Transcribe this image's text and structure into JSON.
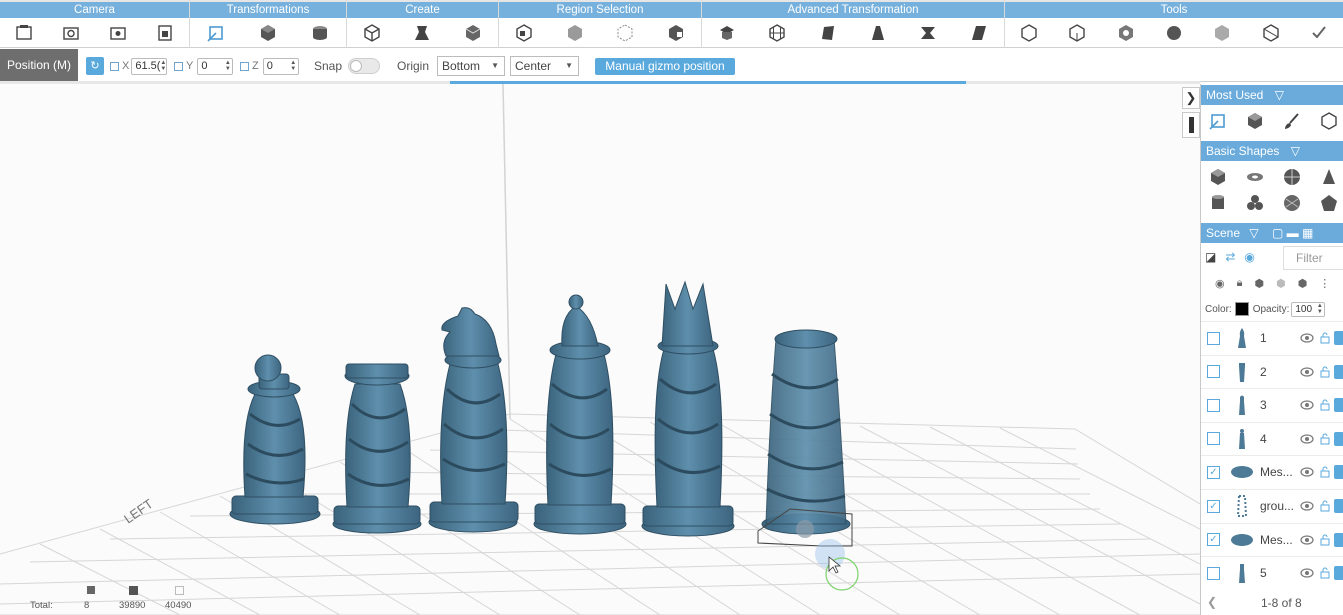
{
  "ribbon": {
    "groups": [
      {
        "title": "Camera"
      },
      {
        "title": "Transformations"
      },
      {
        "title": "Create"
      },
      {
        "title": "Region Selection"
      },
      {
        "title": "Advanced Transformation"
      },
      {
        "title": "Tools"
      }
    ]
  },
  "toolbar": {
    "position_label": "Position (M)",
    "x_label": "X",
    "x_value": "61.5(",
    "y_label": "Y",
    "y_value": "0",
    "z_label": "Z",
    "z_value": "0",
    "snap_label": "Snap",
    "origin_label": "Origin",
    "origin_value": "Bottom",
    "align_value": "Center",
    "gizmo_button": "Manual gizmo position",
    "progress_fraction": 0.43
  },
  "panel": {
    "most_used": "Most Used",
    "basic_shapes": "Basic Shapes",
    "scene": "Scene",
    "filter_placeholder": "Filter",
    "color_label": "Color:",
    "color_value": "#000000",
    "opacity_label": "Opacity:",
    "opacity_value": "100",
    "items": [
      {
        "name": "1",
        "checked": false
      },
      {
        "name": "2",
        "checked": false
      },
      {
        "name": "3",
        "checked": false
      },
      {
        "name": "4",
        "checked": false
      },
      {
        "name": "Mes...",
        "checked": true
      },
      {
        "name": "grou...",
        "checked": true
      },
      {
        "name": "Mes...",
        "checked": true
      },
      {
        "name": "5",
        "checked": false
      }
    ],
    "pager": "1-8 of 8"
  },
  "viewport": {
    "axis_label": "LEFT"
  },
  "stats": {
    "total_label": "Total:",
    "values": [
      "8",
      "39890",
      "40490"
    ]
  },
  "colors": {
    "accent": "#5aa9dd",
    "model": "#4d7a96",
    "header": "#76b0dc"
  }
}
